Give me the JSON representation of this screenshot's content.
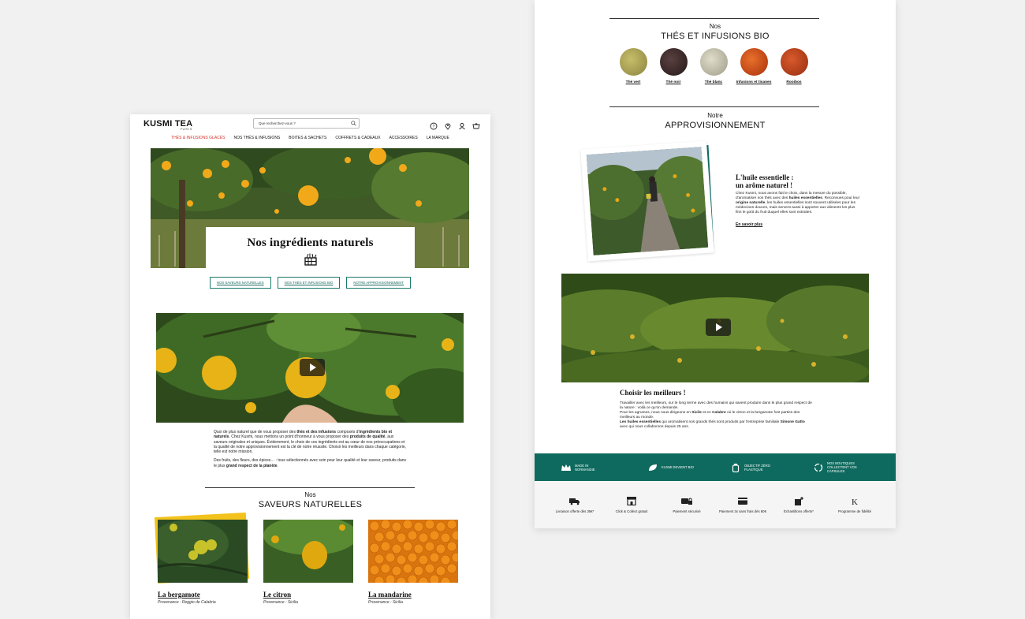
{
  "left_page": {
    "logo": {
      "brand": "KUSMI TEA",
      "sub": "PARIS"
    },
    "search": {
      "placeholder": "Que recherchez-vous ?"
    },
    "nav": [
      "Thés & infusions glacés",
      "Nos thés & infusions",
      "Boites & sachets",
      "Coffrets & cadeaux",
      "Accessoires",
      "La marque"
    ],
    "hero_title": "Nos ingrédients naturels",
    "anchors": [
      "Nos saveurs naturelles",
      "Nos thés et infusions bio",
      "Notre approvisionnement"
    ],
    "intro_p1_a": "Quoi de plus naturel que de vous proposer des ",
    "intro_p1_b": "thés et des infusions",
    "intro_p1_c": " composés d'",
    "intro_p1_d": "ingrédients bio et naturels",
    "intro_p1_e": ". Chez Kusmi, nous mettons un point d'honneur à vous proposer des ",
    "intro_p1_f": "produits de qualité",
    "intro_p1_g": ", aux saveurs originales et uniques. Évidemment, le choix de ces ingrédients est au cœur de nos préoccupations et la qualité de notre approvisionnement est la clé de notre réussite. Choisir les meilleurs dans chaque catégorie, telle est notre mission.",
    "intro_p2_a": "Des fruits, des fleurs, des épices… : tous sélectionnés avec soin pour leur qualité et leur saveur, produits dans le plus ",
    "intro_p2_b": "grand respect de la planète",
    "intro_p2_c": ".",
    "flavours_pre": "Nos",
    "flavours_title": "Saveurs naturelles",
    "cards": [
      {
        "name": "La bergamote",
        "prov": "Provenance : Reggio de Calabria"
      },
      {
        "name": "Le citron",
        "prov": "Provenance : Sicilia"
      },
      {
        "name": "La mandarine",
        "prov": "Provenance : Sicilia"
      }
    ]
  },
  "right_page": {
    "teas_pre": "Nos",
    "teas_title": "Thés et infusions bio",
    "teas": [
      {
        "label": "Thé vert",
        "color": "#a8a055"
      },
      {
        "label": "Thé noir",
        "color": "#3a2a2a"
      },
      {
        "label": "Thé blanc",
        "color": "#c9c6b3"
      },
      {
        "label": "Infusions et tisanes",
        "color": "#c9481c"
      },
      {
        "label": "Rooibos",
        "color": "#b9401f"
      }
    ],
    "supply_pre": "Notre",
    "supply_title": "Approvisionnement",
    "oil_title_1": "L'huile essentielle :",
    "oil_title_2": "un arôme naturel !",
    "oil_text_a": "Chez Kusmi, nous avons fait le choix, dans la mesure du possible, d'aromatiser nos thés avec des ",
    "oil_text_b": "huiles essentielles",
    "oil_text_c": ". Reconnues pour leur ",
    "oil_text_d": "origine naturelle",
    "oil_text_e": ", les huiles essentielles sont souvent utilisées pour les médecines douces, mais servent aussi à apporter aux aliments les plus fins le goût du fruit duquel elles sont extraites.",
    "oil_link": "En savoir plus",
    "best_title": "Choisir les meilleurs !",
    "best_1": "Travailler avec les meilleurs, sur le long terme avec des humains qui savent produire dans le plus grand respect de la nature : voilà ce qu'on demande.",
    "best_2a": "Pour les agrumes, nous nous dirigeons en ",
    "best_2b": "Sicile",
    "best_2c": " et en ",
    "best_2d": "Calabre",
    "best_2e": " où le citron et la bergamote font parties des meilleurs au monde.",
    "best_3a": "Les huiles essentielles",
    "best_3b": " qui aromatisent nos grands thés sont produits par l'entreprise familiale ",
    "best_3c": "Simone Gatto",
    "best_3d": " avec qui nous collaborons depuis 25 ans.",
    "band": [
      "Made in Normandie",
      "Kusmi devient bio",
      "Objectif zéro plastique",
      "Nos boutiques collectent vos capsules"
    ],
    "services": [
      "Livraison offerte dès 35€*",
      "Click & Collect gratuit",
      "Paiement sécurisé",
      "Paiement 3x sans frais dès 60€",
      "Échantillons offerts*",
      "Programme de fidélité"
    ]
  },
  "colors": {
    "accent_teal": "#0e6a5e",
    "nav_active": "#d9342b",
    "background": "#f1f1f1"
  }
}
